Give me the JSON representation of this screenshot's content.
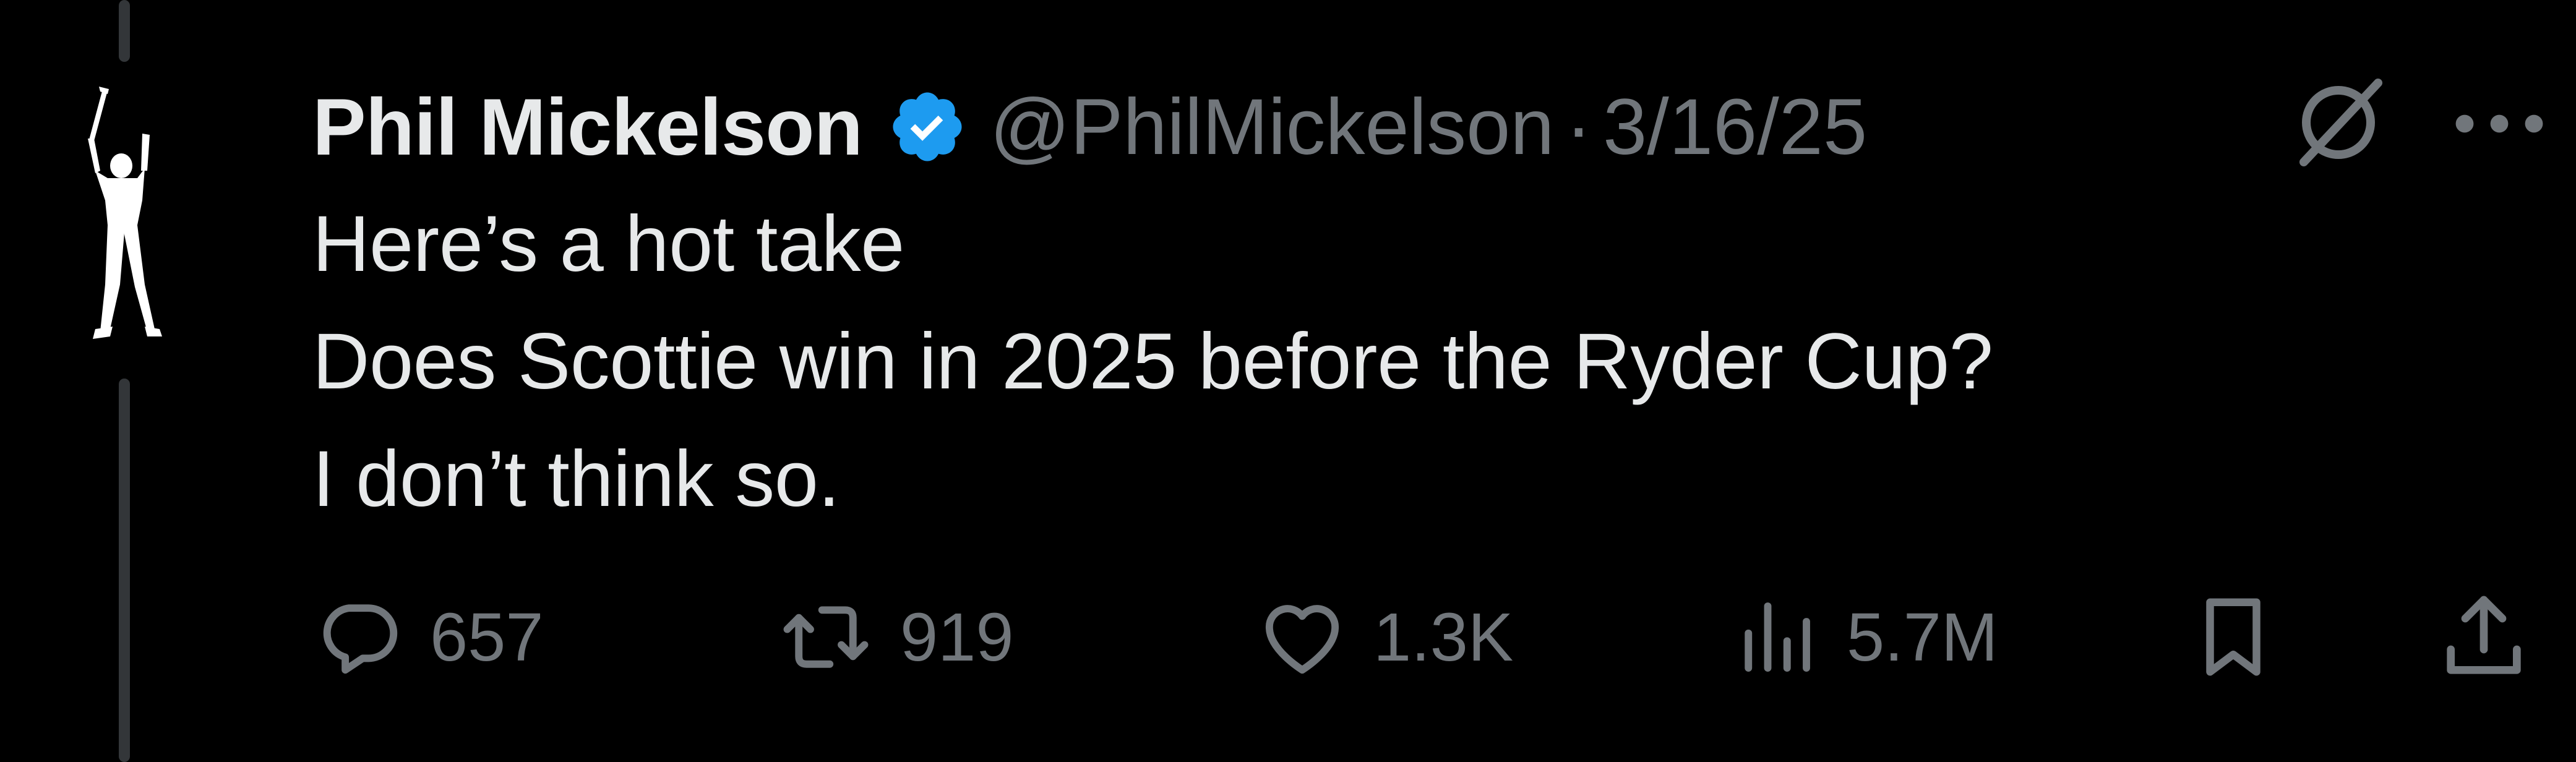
{
  "author": {
    "display_name": "Phil Mickelson",
    "handle": "@PhilMickelson",
    "separator": "·",
    "date": "3/16/25",
    "verified": true,
    "verified_color": "#1d9bf0"
  },
  "tweet": {
    "lines": [
      "Here’s a hot take",
      "Does Scottie win in 2025 before the Ryder Cup?",
      "I don’t think so."
    ]
  },
  "actions": {
    "reply_count": "657",
    "retweet_count": "919",
    "like_count": "1.3K",
    "view_count": "5.7M"
  },
  "icons": {
    "avatar": "golfer-silhouette-icon",
    "verified": "verified-badge-icon",
    "grok": "grok-icon",
    "more": "more-icon",
    "reply": "reply-icon",
    "retweet": "retweet-icon",
    "like": "heart-icon",
    "views": "views-icon",
    "bookmark": "bookmark-icon",
    "share": "share-icon"
  },
  "colors": {
    "background": "#000000",
    "text_primary": "#e7e9ea",
    "text_secondary": "#71767b",
    "thread_line": "#333639"
  }
}
